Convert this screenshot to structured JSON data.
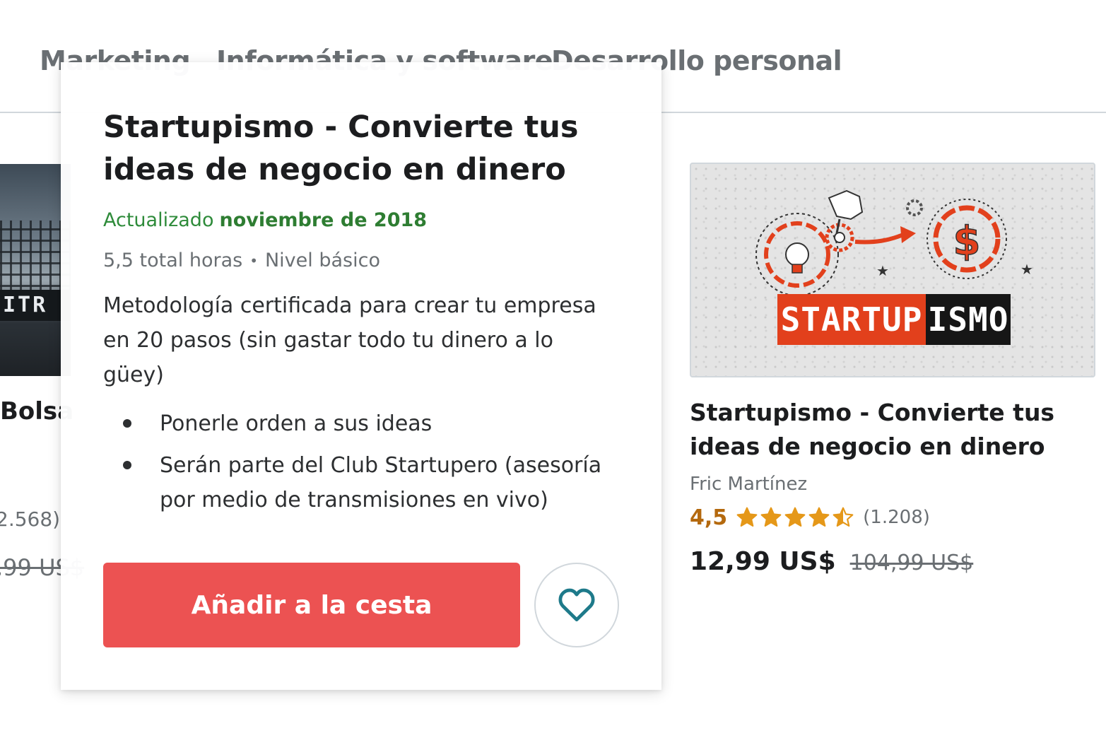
{
  "tabs": {
    "items": [
      {
        "label": "Marketing"
      },
      {
        "label": "Informática y software"
      },
      {
        "label": "Desarrollo personal"
      }
    ]
  },
  "left_card": {
    "thumb_text": "ITR",
    "title": "Bolsa",
    "rating_count": "2.568)",
    "price_old": ",99 US$"
  },
  "popover": {
    "title": "Startupismo - Convierte tus ideas de negocio en dinero",
    "updated_label": "Actualizado",
    "updated_date": "noviembre de 2018",
    "duration": "5,5 total horas",
    "separator": "•",
    "level": "Nivel básico",
    "description": "Metodología certificada para crear tu empresa en 20 pasos (sin gastar todo tu dinero a lo güey)",
    "objectives": [
      "Ponerle orden a sus ideas",
      "Serán parte del Club Startupero (asesoría por medio de transmisiones en vivo)"
    ],
    "add_to_cart_label": "Añadir a la cesta",
    "wishlist_icon": "heart-icon"
  },
  "course_card": {
    "thumbnail_text": "STARTUPISMO",
    "thumbnail_text_red": "STARTUP",
    "thumbnail_text_black": "ISMO",
    "title": "Startupismo - Convierte tus ideas de negocio en dinero",
    "author": "Fric Martínez",
    "rating": "4,5",
    "rating_value": 4.5,
    "rating_max": 5,
    "rating_count": "(1.208)",
    "price_current": "12,99 US$",
    "price_original": "104,99 US$"
  },
  "colors": {
    "accent_red": "#ec5252",
    "rating_orange": "#b4690e",
    "star_orange": "#e59819",
    "updated_green": "#2e7d32",
    "heart_teal": "#1e7a8a"
  }
}
